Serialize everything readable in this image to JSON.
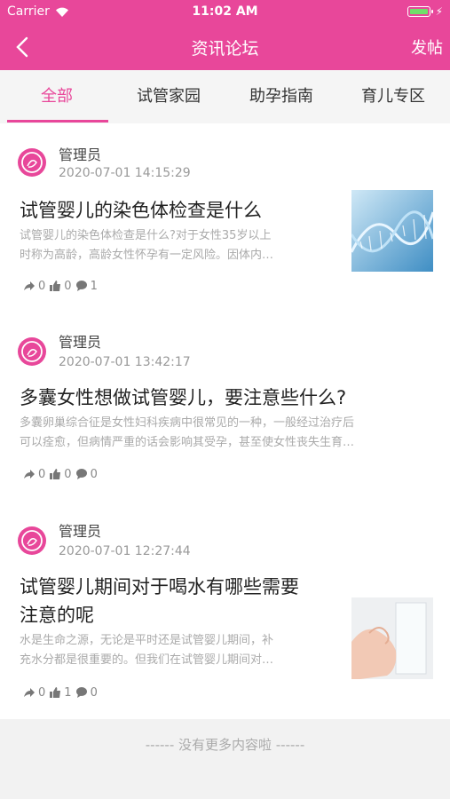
{
  "status_bar": {
    "carrier": "Carrier",
    "time": "11:02 AM"
  },
  "nav": {
    "title": "资讯论坛",
    "post_label": "发帖"
  },
  "tabs": [
    {
      "label": "全部",
      "active": true
    },
    {
      "label": "试管家园",
      "active": false
    },
    {
      "label": "助孕指南",
      "active": false
    },
    {
      "label": "育儿专区",
      "active": false
    }
  ],
  "posts": [
    {
      "author": "管理员",
      "date": "2020-07-01 14:15:29",
      "title_lines": [
        "试管婴儿的染色体检查是什么"
      ],
      "excerpt_lines": [
        "试管婴儿的染色体检查是什么?对于女性35岁以上",
        "时称为高龄，高龄女性怀孕有一定风险。因体内…"
      ],
      "shares": "0",
      "likes": "0",
      "comments": "1",
      "thumbnail": "dna-image"
    },
    {
      "author": "管理员",
      "date": "2020-07-01 13:42:17",
      "title_lines": [
        "多囊女性想做试管婴儿，要注意些什么?"
      ],
      "excerpt_lines": [
        "多囊卵巢综合征是女性妇科疾病中很常见的一种，一般经过治疗后",
        "可以痊愈，但病情严重的话会影响其受孕，甚至使女性丧失生育…"
      ],
      "shares": "0",
      "likes": "0",
      "comments": "0",
      "thumbnail": null
    },
    {
      "author": "管理员",
      "date": "2020-07-01 12:27:44",
      "title_lines": [
        "试管婴儿期间对于喝水有哪些需要",
        "注意的呢"
      ],
      "excerpt_lines": [
        "水是生命之源，无论是平时还是试管婴儿期间，补",
        "充水分都是很重要的。但我们在试管婴儿期间对…"
      ],
      "shares": "0",
      "likes": "1",
      "comments": "0",
      "thumbnail": "water-glass-image"
    }
  ],
  "footer": {
    "no_more_text": "------ 没有更多内容啦 ------"
  },
  "colors": {
    "brand": "#e8479a",
    "tab_bg": "#f5f5f5",
    "footer_bg": "#f2f2f2"
  }
}
